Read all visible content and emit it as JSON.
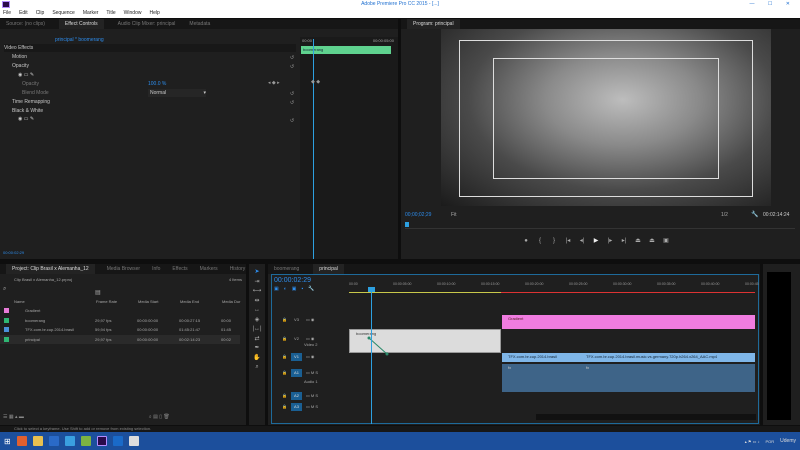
{
  "window": {
    "title": "Adobe Premiere Pro CC 2015 - [...]",
    "controls": "— ☐ ✕"
  },
  "menu": [
    "File",
    "Edit",
    "Clip",
    "Sequence",
    "Marker",
    "Title",
    "Window",
    "Help"
  ],
  "effect_controls": {
    "tabs": [
      "Source: (no clips)",
      "Effect Controls",
      "Audio Clip Mixer: principal",
      "Metadata"
    ],
    "clip_path": "principal * boomerang",
    "section": "Video Effects",
    "effects": [
      {
        "name": "Motion"
      },
      {
        "name": "Opacity"
      },
      {
        "name": "Opacity",
        "value": "100.0 %"
      },
      {
        "name": "Blend Mode",
        "value": "Normal"
      },
      {
        "name": "Time Remapping"
      },
      {
        "name": "Black & White"
      }
    ],
    "mini_timeline": {
      "start": "00:00",
      "end": "00:00:05:00",
      "clip_label": "boomerang"
    },
    "timecode": "00:00:02:29"
  },
  "program": {
    "title": "Program: principal",
    "timecode": "00;00;02;29",
    "fit": "Fit",
    "quality": "1/2",
    "duration": "00:02:14:24"
  },
  "project": {
    "tabs": [
      "Project: Clip Brasil x Alemanha_12",
      "Media Browser",
      "Info",
      "Effects",
      "Markers",
      "History"
    ],
    "path": "Clip Brasil x Alemanha_12.prproj",
    "count": "4 Items",
    "columns": [
      "Name",
      "Frame Rate",
      "Media Start",
      "Media End",
      "Media Dur"
    ],
    "rows": [
      {
        "name": "Gradient",
        "rate": "",
        "start": "",
        "end": "",
        "dur": "",
        "color": "#e87ad8"
      },
      {
        "name": "boomerang",
        "rate": "29,97 fps",
        "start": "00:00:00:00",
        "end": "00:00:27:15",
        "dur": "00:00",
        "color": "#2fb673"
      },
      {
        "name": "TFX.com.br.cup.2014.brasil",
        "rate": "59,94 fps",
        "start": "00:00:00:00",
        "end": "01:45:21:47",
        "dur": "01:45",
        "color": "#4a90d9"
      },
      {
        "name": "principal",
        "rate": "29,97 fps",
        "start": "00:00:00:00",
        "end": "00:02:14:23",
        "dur": "00:02",
        "color": "#2fb673"
      }
    ]
  },
  "timeline": {
    "tabs": [
      "boomerang",
      "principal"
    ],
    "timecode": "00:00:02:29",
    "ruler": [
      "00:00",
      "00:00:05:00",
      "00:00:10:00",
      "00:00:15:00",
      "00:00:20:00",
      "00:00:25:00",
      "00:00:30:00",
      "00:00:35:00",
      "00:00:40:00",
      "00:00:45"
    ],
    "tracks": [
      "V3",
      "V2",
      "V1",
      "A1",
      "A2",
      "A3"
    ],
    "track_names": {
      "v2": "Video 2",
      "a1": "Audio 1"
    },
    "clips": {
      "gradient": "Gradient",
      "boomerang": "boomerang",
      "v1a": "TFX.com.br.cup.2014.brasil",
      "v1b": "TFX.com.br.cup.2014.brasil.music.vs.germany.720p.h264.x264_AAC.mp4",
      "a1a": "fx",
      "a1b": "fx"
    }
  },
  "status": "Click to select a keyframe. Use Shift to add or remove from existing selection.",
  "taskbar": {
    "lang": "POR",
    "time": "Udemy"
  },
  "colors": {
    "accent": "#2d8ceb",
    "gradient_clip": "#f07ce0",
    "video_clip": "#7fb6e8",
    "audio_clip": "#3e6488",
    "effect_bar": "#5fd28f"
  }
}
